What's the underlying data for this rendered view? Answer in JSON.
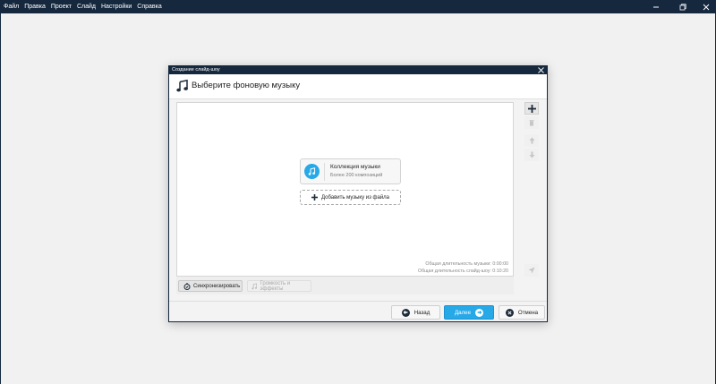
{
  "window": {
    "menu": [
      "Файл",
      "Правка",
      "Проект",
      "Слайд",
      "Настройки",
      "Справка"
    ]
  },
  "dialog": {
    "title": "Создание слайд-шоу",
    "heading": "Выберите фоновую музыку",
    "collection": {
      "title": "Коллекция музыки",
      "subtitle": "Более 200 композиций"
    },
    "add_file_label": "Добавить музыку из файла",
    "total_music_duration": "Общая длительность музыки: 0:00:00",
    "total_slideshow_duration": "Общая длительность слайд-шоу: 0:10:20",
    "sync_label": "Синхронизировать",
    "volume_label": "Громкость и эффекты",
    "buttons": {
      "back": "Назад",
      "next": "Далее",
      "cancel": "Отмена"
    }
  },
  "colors": {
    "titlebar": "#15283e",
    "accent": "#27a9e8"
  }
}
